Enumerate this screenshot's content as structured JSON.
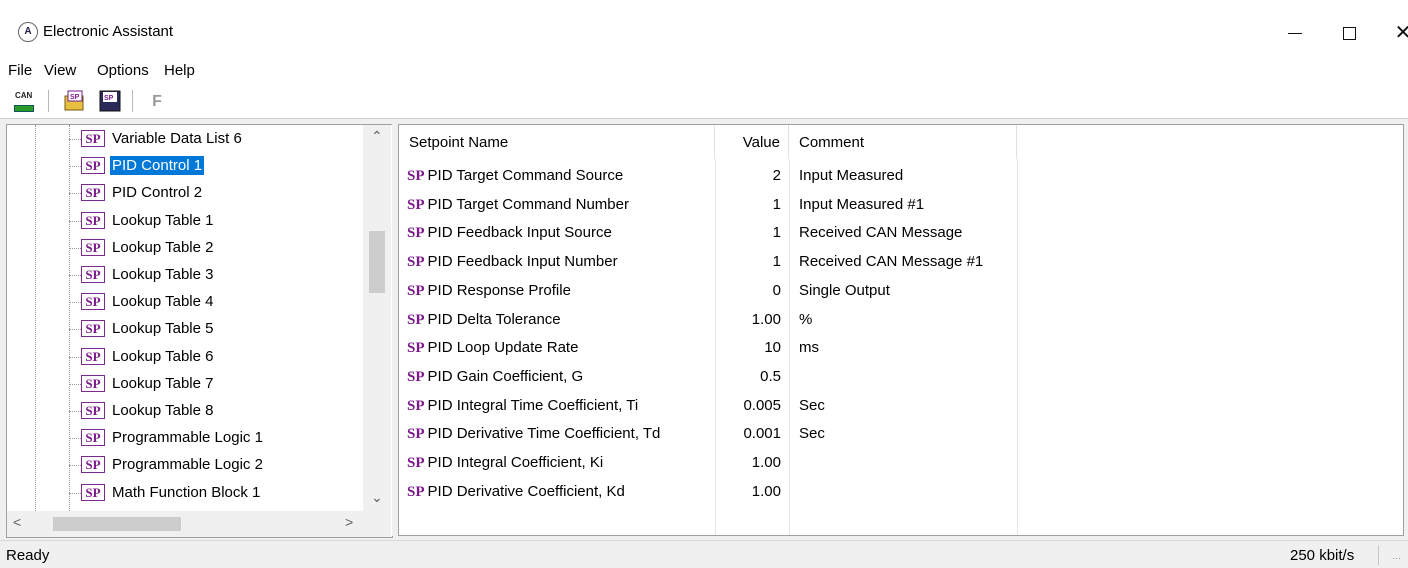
{
  "window": {
    "title": "Electronic Assistant",
    "app_icon_glyph": "A",
    "close_glyph": "✕"
  },
  "menu": [
    "File",
    "View",
    "Options",
    "Help"
  ],
  "toolbar": {
    "can_label": "CAN",
    "open_label": "SP",
    "save_label": "SP",
    "function_label": "F"
  },
  "tree": {
    "icon_label": "SP",
    "items": [
      {
        "label": "Variable Data List 6",
        "selected": false
      },
      {
        "label": "PID Control 1",
        "selected": true
      },
      {
        "label": "PID Control 2",
        "selected": false
      },
      {
        "label": "Lookup Table 1",
        "selected": false
      },
      {
        "label": "Lookup Table 2",
        "selected": false
      },
      {
        "label": "Lookup Table 3",
        "selected": false
      },
      {
        "label": "Lookup Table 4",
        "selected": false
      },
      {
        "label": "Lookup Table 5",
        "selected": false
      },
      {
        "label": "Lookup Table 6",
        "selected": false
      },
      {
        "label": "Lookup Table 7",
        "selected": false
      },
      {
        "label": "Lookup Table 8",
        "selected": false
      },
      {
        "label": "Programmable Logic 1",
        "selected": false
      },
      {
        "label": "Programmable Logic 2",
        "selected": false
      },
      {
        "label": "Math Function Block 1",
        "selected": false
      }
    ]
  },
  "table": {
    "columns": {
      "name": "Setpoint Name",
      "value": "Value",
      "comment": "Comment"
    },
    "row_prefix": "SP",
    "rows": [
      {
        "name": "PID Target Command Source",
        "value": "2",
        "comment": "Input Measured"
      },
      {
        "name": "PID Target Command Number",
        "value": "1",
        "comment": "Input Measured #1"
      },
      {
        "name": "PID Feedback Input Source",
        "value": "1",
        "comment": "Received CAN Message"
      },
      {
        "name": "PID Feedback Input Number",
        "value": "1",
        "comment": "Received CAN Message #1"
      },
      {
        "name": "PID Response Profile",
        "value": "0",
        "comment": "Single Output"
      },
      {
        "name": "PID Delta Tolerance",
        "value": "1.00",
        "comment": "%"
      },
      {
        "name": "PID Loop Update Rate",
        "value": "10",
        "comment": "ms"
      },
      {
        "name": "PID Gain Coefficient, G",
        "value": "0.5",
        "comment": ""
      },
      {
        "name": "PID Integral Time Coefficient, Ti",
        "value": "0.005",
        "comment": "Sec"
      },
      {
        "name": "PID Derivative Time Coefficient, Td",
        "value": "0.001",
        "comment": "Sec"
      },
      {
        "name": "PID Integral Coefficient, Ki",
        "value": "1.00",
        "comment": ""
      },
      {
        "name": "PID Derivative Coefficient, Kd",
        "value": "1.00",
        "comment": ""
      }
    ]
  },
  "status": {
    "left": "Ready",
    "right": "250 kbit/s"
  },
  "colors": {
    "selection": "#0078d7",
    "sp_icon": "#7a1a8a"
  }
}
